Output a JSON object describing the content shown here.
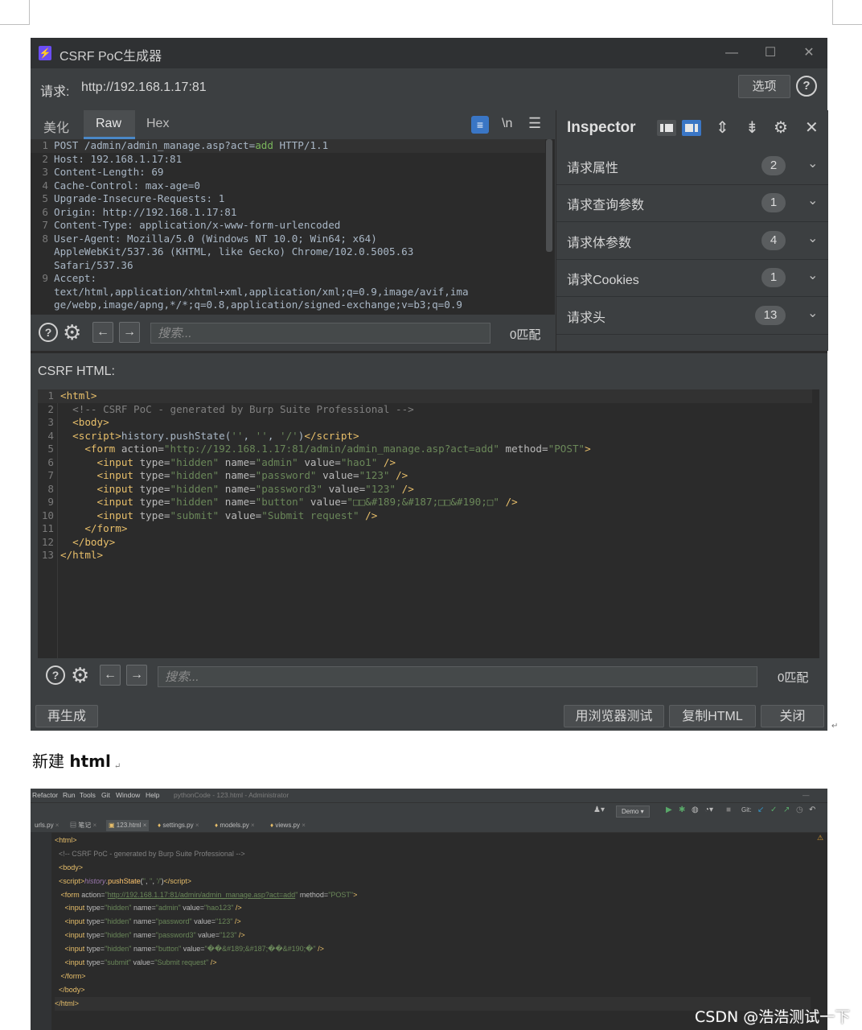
{
  "burp": {
    "title": "CSRF PoC生成器",
    "request_label": "请求:",
    "request_url": "http://192.168.1.17:81",
    "options_button": "选项",
    "tabs": [
      "美化",
      "Raw",
      "Hex"
    ],
    "newline_label": "\\n",
    "request_lines": [
      {
        "n": "1",
        "pre": "POST /admin/admin_manage.asp?act=",
        "green": "add",
        "post": " HTTP/1.1"
      },
      {
        "n": "2",
        "pre": "Host: 192.168.1.17:81",
        "green": "",
        "post": ""
      },
      {
        "n": "3",
        "pre": "Content-Length: 69",
        "green": "",
        "post": ""
      },
      {
        "n": "4",
        "pre": "Cache-Control: max-age=0",
        "green": "",
        "post": ""
      },
      {
        "n": "5",
        "pre": "Upgrade-Insecure-Requests: 1",
        "green": "",
        "post": ""
      },
      {
        "n": "6",
        "pre": "Origin: http://192.168.1.17:81",
        "green": "",
        "post": ""
      },
      {
        "n": "7",
        "pre": "Content-Type: application/x-www-form-urlencoded",
        "green": "",
        "post": ""
      },
      {
        "n": "8",
        "pre": "User-Agent: Mozilla/5.0 (Windows NT 10.0; Win64; x64)",
        "green": "",
        "post": ""
      },
      {
        "n": "",
        "pre": "AppleWebKit/537.36 (KHTML, like Gecko) Chrome/102.0.5005.63",
        "green": "",
        "post": ""
      },
      {
        "n": "",
        "pre": "Safari/537.36",
        "green": "",
        "post": ""
      },
      {
        "n": "9",
        "pre": "Accept:",
        "green": "",
        "post": ""
      },
      {
        "n": "",
        "pre": "text/html,application/xhtml+xml,application/xml;q=0.9,image/avif,ima",
        "green": "",
        "post": ""
      },
      {
        "n": "",
        "pre": "ge/webp,image/apng,*/*;q=0.8,application/signed-exchange;v=b3;q=0.9",
        "green": "",
        "post": ""
      }
    ],
    "search_placeholder": "搜索...",
    "request_matches": "0匹配",
    "inspector": {
      "title": "Inspector",
      "sections": [
        {
          "label": "请求属性",
          "count": "2"
        },
        {
          "label": "请求查询参数",
          "count": "1"
        },
        {
          "label": "请求体参数",
          "count": "4"
        },
        {
          "label": "请求Cookies",
          "count": "1"
        },
        {
          "label": "请求头",
          "count": "13"
        }
      ]
    },
    "csrf_heading": "CSRF HTML:",
    "csrf_matches": "0匹配",
    "buttons": {
      "regenerate": "再生成",
      "test_in_browser": "用浏览器测试",
      "copy_html": "复制HTML",
      "close": "关闭"
    }
  },
  "caption": {
    "text": "新建",
    "bold": "html"
  },
  "ide": {
    "menu": [
      "Refactor",
      "Run",
      "Tools",
      "Git",
      "Window",
      "Help"
    ],
    "project_title": "pythonCode - 123.html - Administrator",
    "run_config": "Demo ▾",
    "git_label": "Git:",
    "tabs": [
      "urls.py",
      "笔记",
      "123.html",
      "settings.py",
      "models.py",
      "views.py"
    ]
  },
  "watermark": "CSDN @浩浩测试一下",
  "colors": {
    "window_bg": "#3c3f41",
    "editor_bg": "#2b2b2b",
    "accent": "#3a76c5",
    "tag": "#e8bf6a",
    "string": "#6a8759"
  }
}
